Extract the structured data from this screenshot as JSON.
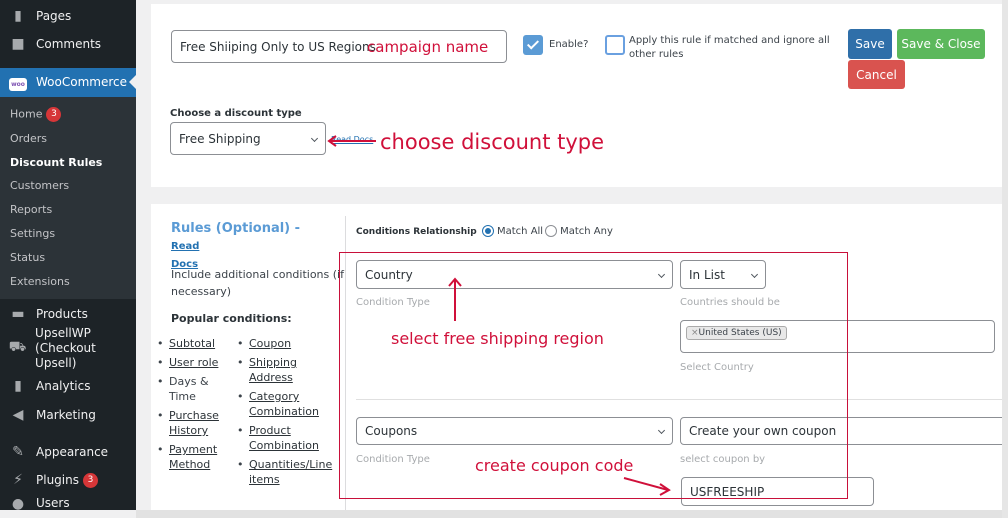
{
  "sidebar": {
    "top_items": [
      {
        "label": "Pages",
        "icon": "pages-icon"
      },
      {
        "label": "Comments",
        "icon": "comments-icon"
      }
    ],
    "woocommerce": {
      "label": "WooCommerce",
      "icon_text": "woo"
    },
    "submenu": [
      {
        "label": "Home",
        "badge": "3"
      },
      {
        "label": "Orders"
      },
      {
        "label": "Discount Rules",
        "current": true
      },
      {
        "label": "Customers"
      },
      {
        "label": "Reports"
      },
      {
        "label": "Settings"
      },
      {
        "label": "Status"
      },
      {
        "label": "Extensions"
      }
    ],
    "bottom_items": [
      {
        "label": "Products",
        "icon": "products-icon"
      },
      {
        "label": "UpsellWP",
        "label2": "(Checkout Upsell)",
        "icon": "cart-icon"
      },
      {
        "label": "Analytics",
        "icon": "analytics-icon"
      },
      {
        "label": "Marketing",
        "icon": "megaphone-icon"
      },
      {
        "label": "Appearance",
        "icon": "brush-icon"
      },
      {
        "label": "Plugins",
        "badge": "3",
        "icon": "plugin-icon"
      },
      {
        "label": "Users",
        "icon": "user-icon"
      }
    ]
  },
  "rule": {
    "campaign_name_value": "Free Shiiping Only to US Regions",
    "enable_label": "Enable?",
    "enable_checked": true,
    "exclusive_label_line1": "Apply this rule if matched and ignore all",
    "exclusive_label_line2": "other rules",
    "exclusive_checked": false,
    "save_label": "Save",
    "save_close_label": "Save & Close",
    "cancel_label": "Cancel",
    "discount_type_label": "Choose a discount type",
    "discount_type_value": "Free Shipping",
    "read_docs_label": "Read Docs"
  },
  "rules_section": {
    "title": "Rules (Optional) - ",
    "read_label": "Read",
    "docs_label": "Docs",
    "description_line1": "Include additional conditions (if",
    "description_line2": "necessary)",
    "popular_title": "Popular conditions:",
    "col1": [
      {
        "label": "Subtotal",
        "link": true
      },
      {
        "label": "User role",
        "link": true
      },
      {
        "label": "Days & Time",
        "link": false
      },
      {
        "label": "Purchase History",
        "link": true
      },
      {
        "label": "Payment Method",
        "link": true
      }
    ],
    "col2": [
      {
        "label": "Coupon",
        "link": true
      },
      {
        "label": "Shipping Address",
        "link": true
      },
      {
        "label": "Category Combination",
        "link": true
      },
      {
        "label": "Product Combination",
        "link": true
      },
      {
        "label": "Quantities/Line items",
        "link": true
      }
    ]
  },
  "conditions": {
    "relationship_label": "Conditions Relationship",
    "match_all_label": "Match All",
    "match_any_label": "Match Any",
    "selected": "Match All",
    "rows": [
      {
        "type_value": "Country",
        "type_help": "Condition Type",
        "operator_value": "In List",
        "operator_help": "Countries should be",
        "tag": "United States (US)",
        "value_help": "Select Country"
      },
      {
        "type_value": "Coupons",
        "type_help": "Condition Type",
        "operator_value": "Create your own coupon",
        "operator_help": "select coupon by",
        "coupon_value": "USFREESHIP"
      }
    ]
  },
  "annotations": {
    "campaign_name": "campaign name",
    "discount_type": "choose discount type",
    "region": "select free shipping region",
    "coupon": "create coupon code",
    "color": "#d0103a"
  },
  "colors": {
    "sidebar_bg": "#1d2327",
    "submenu_bg": "#2c3338",
    "woo_active": "#2271b1",
    "save": "#2271b1",
    "save_close": "#4caf50",
    "cancel": "#d9534f",
    "rules_title": "#5b9bd5"
  }
}
